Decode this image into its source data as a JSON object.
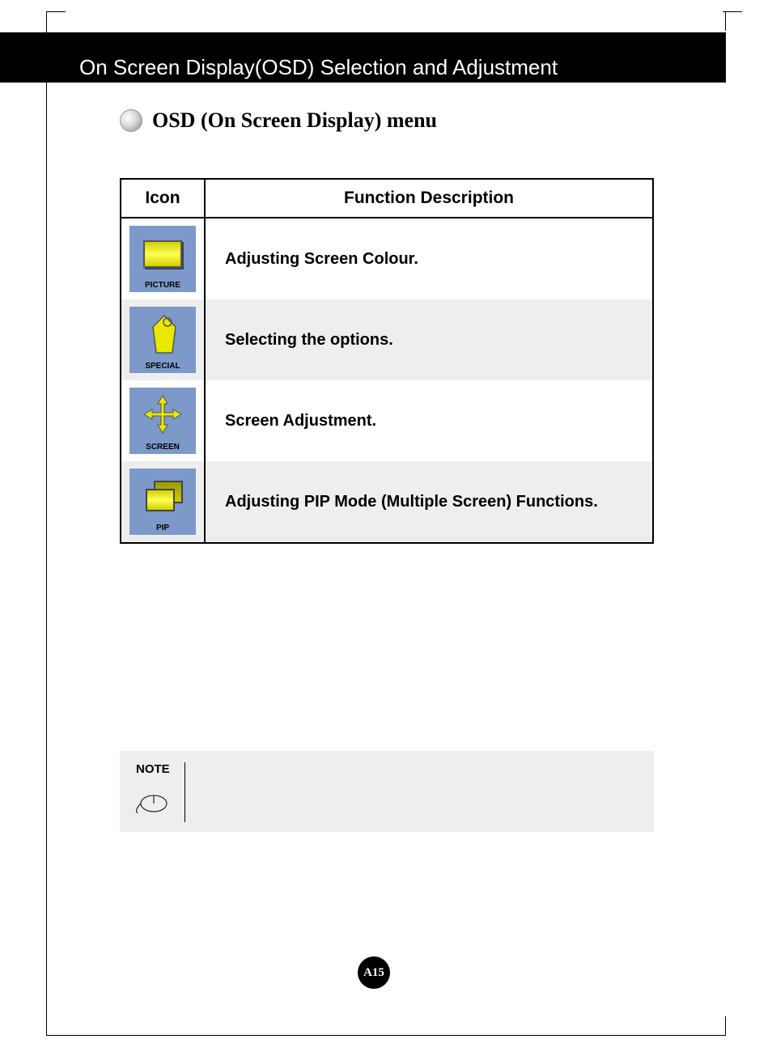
{
  "header": {
    "title": "On Screen Display(OSD) Selection and Adjustment"
  },
  "section": {
    "title": "OSD (On Screen Display) menu"
  },
  "table": {
    "columns": {
      "icon": "Icon",
      "desc": "Function Description"
    },
    "rows": [
      {
        "icon_label": "PICTURE",
        "description": "Adjusting Screen Colour."
      },
      {
        "icon_label": "SPECIAL",
        "description": "Selecting the options."
      },
      {
        "icon_label": "SCREEN",
        "description": "Screen Adjustment."
      },
      {
        "icon_label": "PIP",
        "description": "Adjusting PIP Mode (Multiple Screen) Functions."
      }
    ]
  },
  "note": {
    "label": "NOTE"
  },
  "page_number": "A15"
}
